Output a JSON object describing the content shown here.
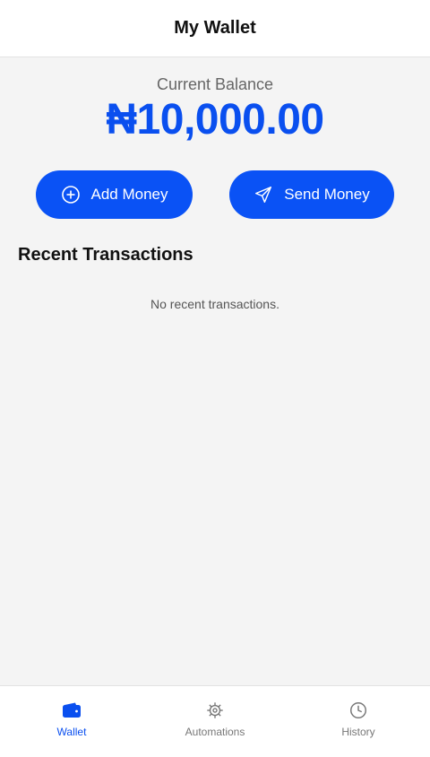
{
  "header": {
    "title": "My Wallet"
  },
  "balance": {
    "label": "Current Balance",
    "amount": "₦10,000.00"
  },
  "actions": {
    "add_money": {
      "label": "Add Money",
      "icon": "plus-circle-icon"
    },
    "send_money": {
      "label": "Send Money",
      "icon": "send-icon"
    }
  },
  "transactions": {
    "title": "Recent Transactions",
    "empty_message": "No recent transactions."
  },
  "nav": {
    "items": [
      {
        "label": "Wallet",
        "icon": "wallet-icon",
        "active": true
      },
      {
        "label": "Automations",
        "icon": "gear-icon",
        "active": false
      },
      {
        "label": "History",
        "icon": "clock-icon",
        "active": false
      }
    ]
  },
  "colors": {
    "accent": "#0a52f5",
    "balance_text": "#0a4fef",
    "background": "#f4f4f4",
    "surface": "#ffffff",
    "nav_inactive": "#777777"
  }
}
